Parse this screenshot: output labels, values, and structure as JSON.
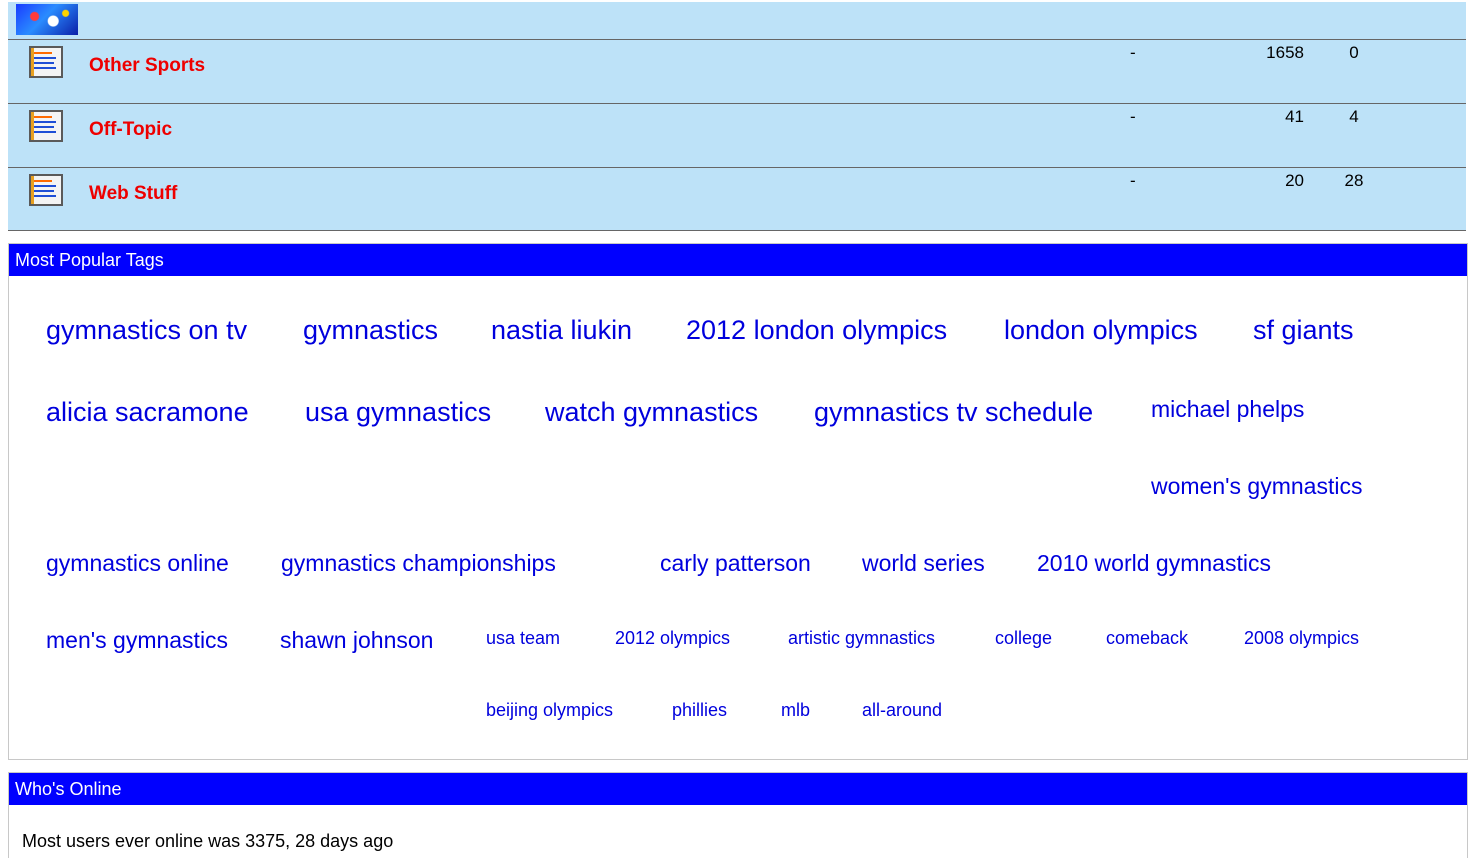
{
  "forums": [
    {
      "name": "Other Sports",
      "last_post": "-",
      "threads": "1658",
      "posts": "0"
    },
    {
      "name": "Off-Topic",
      "last_post": "-",
      "threads": "41",
      "posts": "4"
    },
    {
      "name": "Web Stuff",
      "last_post": "-",
      "threads": "20",
      "posts": "28"
    }
  ],
  "tags_panel": {
    "title": "Most Popular Tags",
    "tags": [
      "gymnastics on tv",
      "gymnastics",
      "nastia liukin",
      "2012 london olympics",
      "london olympics",
      "sf giants",
      "alicia sacramone",
      "usa gymnastics",
      "watch gymnastics",
      "gymnastics tv schedule",
      "michael phelps",
      "women's gymnastics",
      "gymnastics online",
      "gymnastics championships",
      "carly patterson",
      "world series",
      "2010 world gymnastics",
      "men's gymnastics",
      "shawn johnson",
      "usa team",
      "2012 olympics",
      "artistic gymnastics",
      "college",
      "comeback",
      "2008 olympics",
      "beijing olympics",
      "phillies",
      "mlb",
      "all-around"
    ]
  },
  "online_panel": {
    "title": "Who's Online",
    "text": "Most users ever online was 3375, 28 days ago"
  },
  "colors": {
    "forum_bg": "#bde2f8",
    "forum_link": "#ee0000",
    "header_bg": "#0000ff",
    "tag_link": "#0000dd"
  },
  "icons": {
    "forum": "forum-notepad-icon",
    "banner": "forum-banner-image"
  }
}
